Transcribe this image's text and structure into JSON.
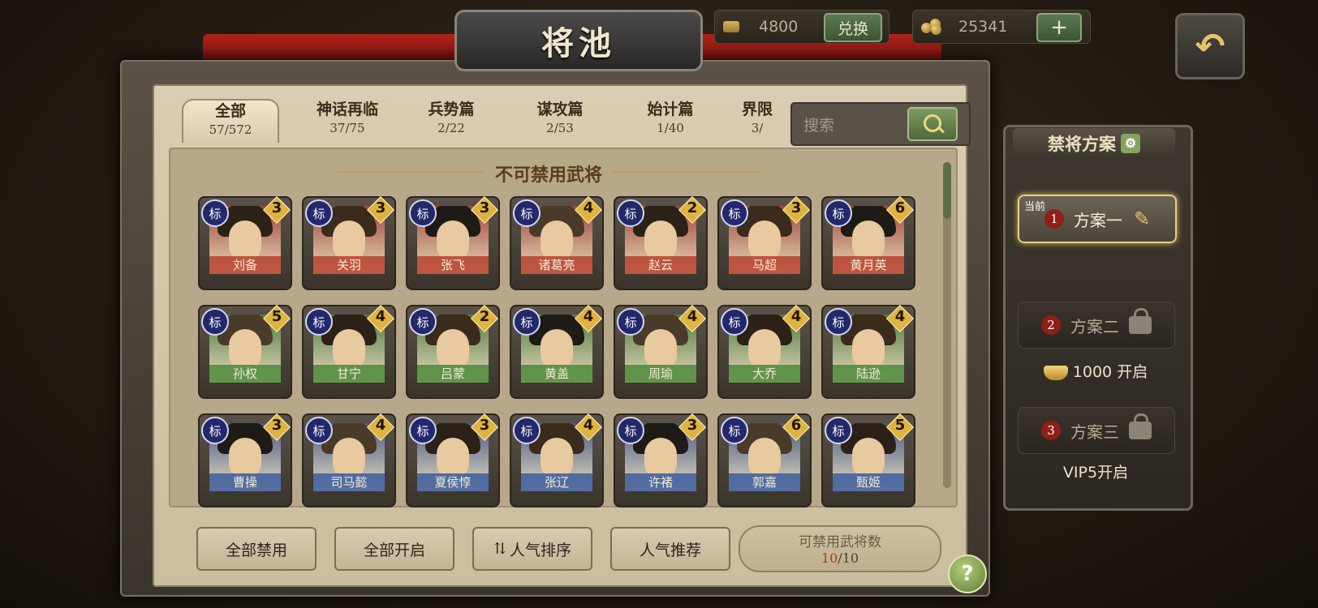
{
  "header": {
    "title": "将池",
    "currency1": {
      "value": "4800",
      "button": "兑换"
    },
    "currency2": {
      "value": "25341",
      "button": "+"
    },
    "back_glyph": "↶"
  },
  "tabs": [
    {
      "name": "全部",
      "count": "57/572",
      "active": true
    },
    {
      "name": "神话再临",
      "count": "37/75"
    },
    {
      "name": "兵势篇",
      "count": "2/22"
    },
    {
      "name": "谋攻篇",
      "count": "2/53"
    },
    {
      "name": "始计篇",
      "count": "1/40"
    },
    {
      "name": "界限",
      "count": "3/"
    }
  ],
  "search": {
    "placeholder": "搜索"
  },
  "section_title": "不可禁用武将",
  "badge_label": "标",
  "generals": [
    {
      "name": "刘备",
      "stars": "3",
      "kingdom": "shu"
    },
    {
      "name": "关羽",
      "stars": "3",
      "kingdom": "shu"
    },
    {
      "name": "张飞",
      "stars": "3",
      "kingdom": "shu"
    },
    {
      "name": "诸葛亮",
      "stars": "4",
      "kingdom": "shu"
    },
    {
      "name": "赵云",
      "stars": "2",
      "kingdom": "shu"
    },
    {
      "name": "马超",
      "stars": "3",
      "kingdom": "shu"
    },
    {
      "name": "黄月英",
      "stars": "6",
      "kingdom": "shu"
    },
    {
      "name": "孙权",
      "stars": "5",
      "kingdom": "wu"
    },
    {
      "name": "甘宁",
      "stars": "4",
      "kingdom": "wu"
    },
    {
      "name": "吕蒙",
      "stars": "2",
      "kingdom": "wu"
    },
    {
      "name": "黄盖",
      "stars": "4",
      "kingdom": "wu"
    },
    {
      "name": "周瑜",
      "stars": "4",
      "kingdom": "wu"
    },
    {
      "name": "大乔",
      "stars": "4",
      "kingdom": "wu"
    },
    {
      "name": "陆逊",
      "stars": "4",
      "kingdom": "wu"
    },
    {
      "name": "曹操",
      "stars": "3",
      "kingdom": "wei"
    },
    {
      "name": "司马懿",
      "stars": "4",
      "kingdom": "wei"
    },
    {
      "name": "夏侯惇",
      "stars": "3",
      "kingdom": "wei"
    },
    {
      "name": "张辽",
      "stars": "4",
      "kingdom": "wei"
    },
    {
      "name": "许褚",
      "stars": "3",
      "kingdom": "wei"
    },
    {
      "name": "郭嘉",
      "stars": "6",
      "kingdom": "wei"
    },
    {
      "name": "甄姬",
      "stars": "5",
      "kingdom": "wei"
    }
  ],
  "kingdom_colors": {
    "shu": "#b8432f",
    "wu": "#4d8a3a",
    "wei": "#3d5e9c"
  },
  "bottom": {
    "ban_all": "全部禁用",
    "open_all": "全部开启",
    "sort_label": "人气排序",
    "sort_icon": "⇅",
    "recommend": "人气推荐",
    "quota_label": "可禁用武将数",
    "quota_used": "10",
    "quota_total": "/10",
    "help": "?"
  },
  "schemes": {
    "title": "禁将方案",
    "gear_glyph": "⚙",
    "current_tag": "当前",
    "items": [
      {
        "num": "1",
        "name": "方案一",
        "status": ""
      },
      {
        "num": "2",
        "name": "方案二",
        "status": "1000 开启"
      },
      {
        "num": "3",
        "name": "方案三",
        "status": "VIP5开启"
      }
    ]
  }
}
